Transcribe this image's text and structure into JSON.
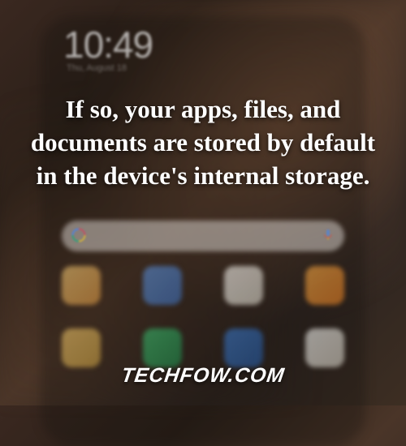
{
  "phone": {
    "clock": "10:49",
    "date": "Thu, August 18"
  },
  "overlay": {
    "text": "If so, your apps, files, and documents are stored by default in the device's internal storage."
  },
  "watermark": {
    "text": "TECHFOW.COM"
  }
}
